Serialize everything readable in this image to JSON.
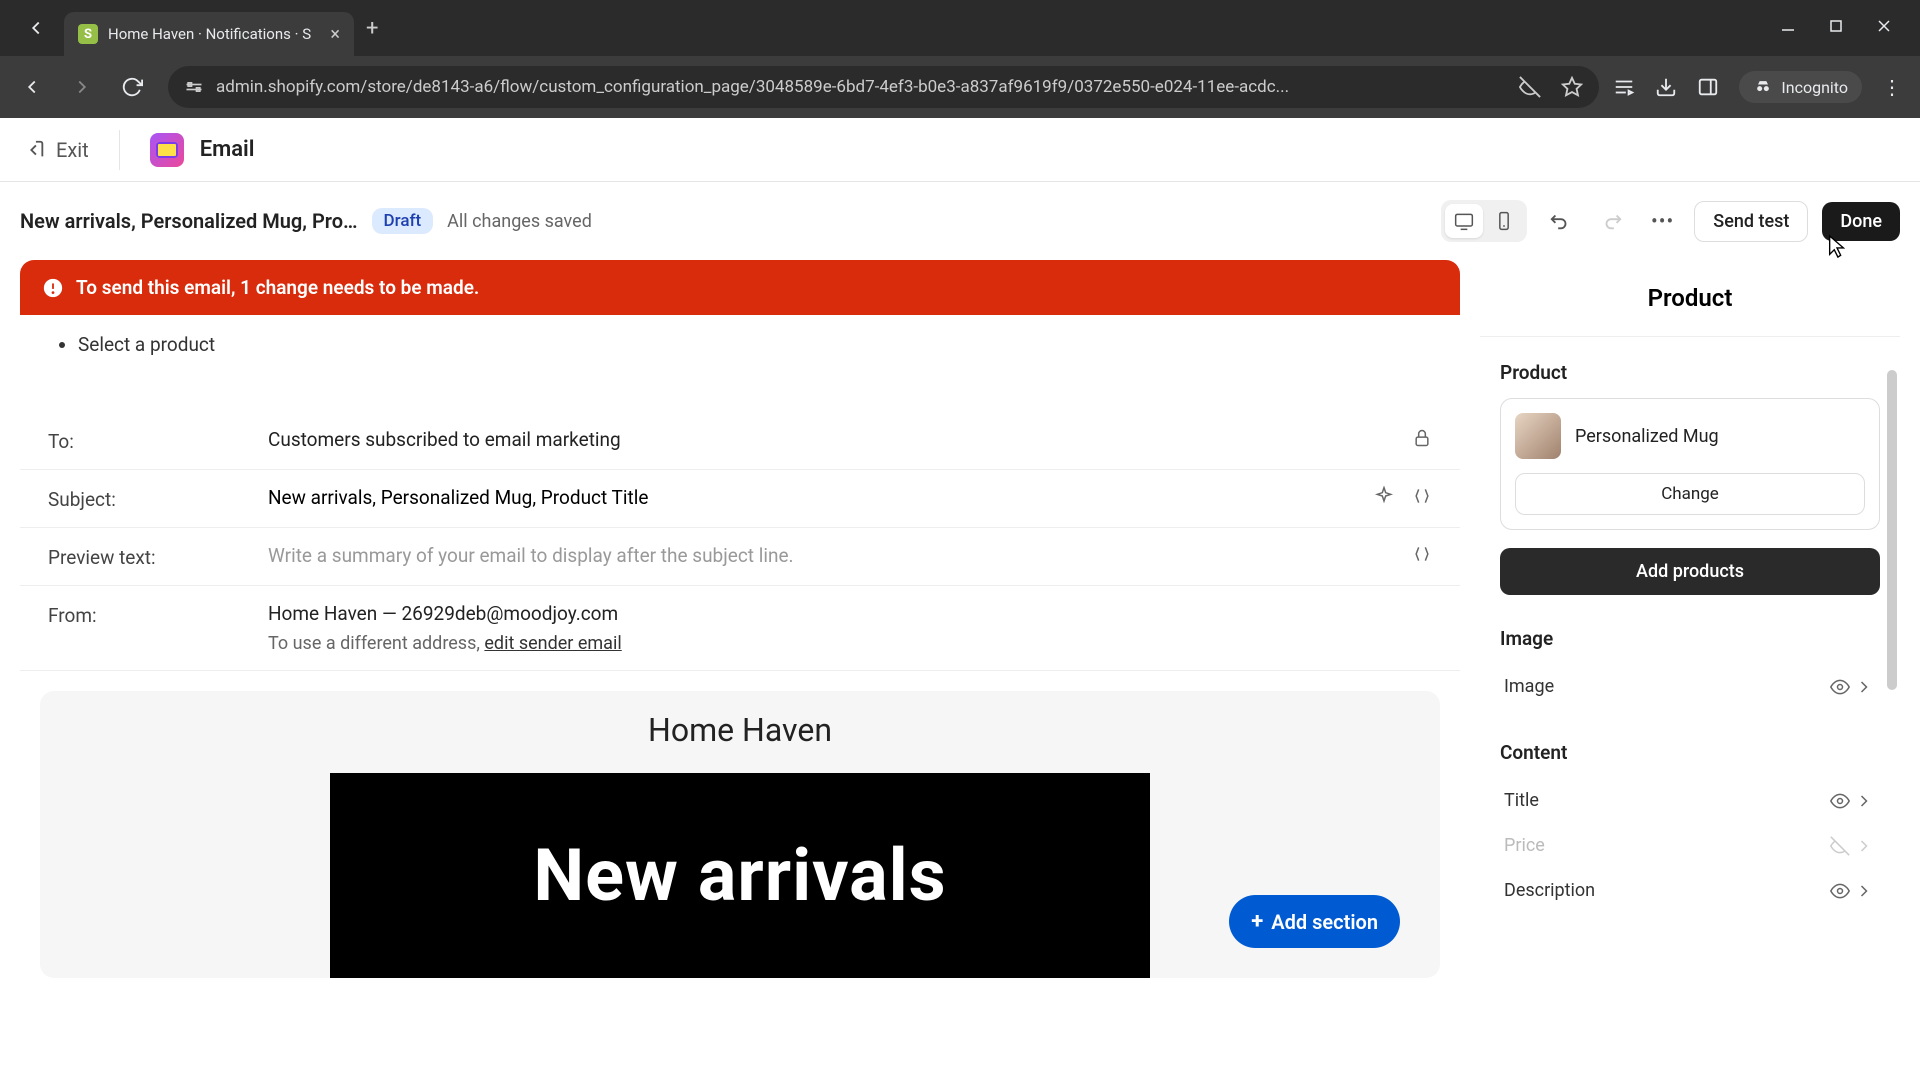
{
  "browser": {
    "tab_title": "Home Haven · Notifications · S",
    "url": "admin.shopify.com/store/de8143-a6/flow/custom_configuration_page/3048589e-6bd7-4ef3-b0e3-a837af9619f9/0372e550-e024-11ee-acdc...",
    "incognito_label": "Incognito"
  },
  "header": {
    "exit": "Exit",
    "app_name": "Email"
  },
  "toolbar": {
    "doc_title": "New arrivals, Personalized Mug, Pro…",
    "status_badge": "Draft",
    "save_status": "All changes saved",
    "send_test": "Send test",
    "done": "Done"
  },
  "alert": {
    "title": "To send this email, 1 change needs to be made.",
    "items": [
      "Select a product"
    ]
  },
  "fields": {
    "to_label": "To:",
    "to_value": "Customers subscribed to email marketing",
    "subject_label": "Subject:",
    "subject_value": "New arrivals, Personalized Mug, Product Title",
    "preview_label": "Preview text:",
    "preview_placeholder": "Write a summary of your email to display after the subject line.",
    "from_label": "From:",
    "from_value": "Home Haven — 26929deb@moodjoy.com",
    "from_note_prefix": "To use a different address, ",
    "from_note_link": "edit sender email"
  },
  "preview": {
    "store_name": "Home Haven",
    "hero_text": "New arrivals",
    "add_section": "Add section"
  },
  "sidebar": {
    "title": "Product",
    "product_section": "Product",
    "product_name": "Personalized Mug",
    "change": "Change",
    "add_products": "Add products",
    "image_section": "Image",
    "image_row": "Image",
    "content_section": "Content",
    "rows": {
      "title": "Title",
      "price": "Price",
      "description": "Description"
    }
  }
}
